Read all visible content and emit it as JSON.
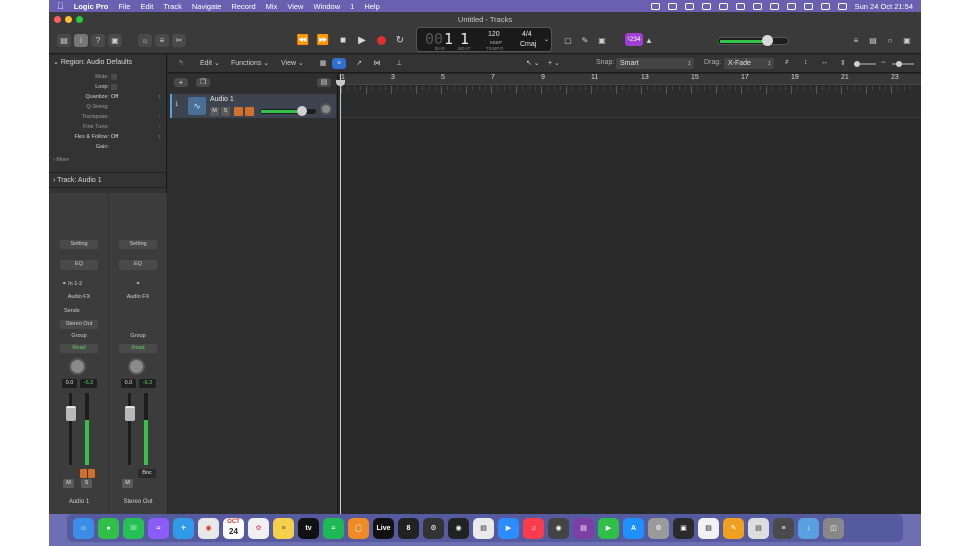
{
  "menubar": {
    "app": "Logic Pro",
    "items": [
      "File",
      "Edit",
      "Track",
      "Navigate",
      "Record",
      "Mix",
      "View",
      "Window",
      "1",
      "Help"
    ],
    "clock": "Sun 24 Oct  21:54"
  },
  "window": {
    "title": "Untitled - Tracks"
  },
  "lcd": {
    "bar_dim": "00",
    "bar": "1",
    "beat": "1",
    "bar_label": "BAR",
    "beat_label": "BEAT",
    "tempo": "120",
    "tempo_mode": "KEEP",
    "tempo_label": "TEMPO",
    "time_sig": "4/4",
    "key": "Cmaj"
  },
  "toolbar": {
    "count_in_badge": "¹234"
  },
  "inspector": {
    "region_header": "Region: Audio Defaults",
    "params": [
      {
        "label": "Mute:",
        "value": "",
        "enabled": false,
        "type": "check"
      },
      {
        "label": "Loop:",
        "value": "",
        "enabled": true,
        "type": "check"
      },
      {
        "label": "Quantize:",
        "value": "Off",
        "enabled": true,
        "type": "select"
      },
      {
        "label": "Q-Swing:",
        "value": "",
        "enabled": false,
        "type": "none"
      },
      {
        "label": "Transpose:",
        "value": "",
        "enabled": false,
        "type": "select"
      },
      {
        "label": "Fine Tune:",
        "value": "",
        "enabled": false,
        "type": "select"
      },
      {
        "label": "Flex & Follow:",
        "value": "Off",
        "enabled": true,
        "type": "select"
      },
      {
        "label": "Gain:",
        "value": "",
        "enabled": true,
        "type": "none"
      }
    ],
    "more_label": "More",
    "track_header": "Track:  Audio 1"
  },
  "strips": [
    {
      "setting": "Setting",
      "eq": "EQ",
      "input": "In 1-2",
      "audio_fx": "Audio FX",
      "sends": "Sends",
      "output": "Stereo Out",
      "group": "Group",
      "automation": "Read",
      "pan_value": "0.0",
      "peak_value": "-6.3",
      "mute": "M",
      "solo": "S",
      "name": "Audio 1",
      "meter_level": 0.62,
      "fader_level": 0.72
    },
    {
      "setting": "Setting",
      "eq": "EQ",
      "audio_fx": "Audio FX",
      "group": "Group",
      "automation": "Read",
      "pan_value": "0.0",
      "peak_value": "-6.3",
      "mute": "M",
      "bounce": "Bnc",
      "name": "Stereo Out",
      "meter_level": 0.62,
      "fader_level": 0.72
    }
  ],
  "tracks_toolbar": {
    "edit": "Edit",
    "functions": "Functions",
    "view": "View",
    "snap_label": "Snap:",
    "snap_value": "Smart",
    "drag_label": "Drag:",
    "drag_value": "X-Fade"
  },
  "ruler": {
    "bars": [
      "1",
      "3",
      "5",
      "7",
      "9",
      "11",
      "13",
      "15",
      "17",
      "19",
      "21",
      "23"
    ]
  },
  "tracks": [
    {
      "number": "1",
      "name": "Audio 1",
      "mute": "M",
      "solo": "S",
      "volume_level": 0.78
    }
  ],
  "dock": {
    "calendar_month": "OCT",
    "calendar_day": "24",
    "live_label": "Live",
    "tv_label": "tv"
  },
  "colors": {
    "accent_blue": "#5aa0e0",
    "record_red": "#e03030",
    "meter_green": "#35c24a",
    "automation_green": "#5fd35f",
    "count_in_purple": "#a03fd4",
    "desktop": "#6e6eb3"
  }
}
